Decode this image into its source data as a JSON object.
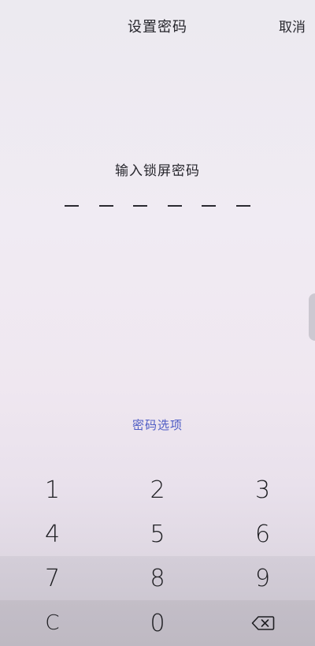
{
  "header": {
    "title": "设置密码",
    "cancel_label": "取消"
  },
  "pin": {
    "prompt": "输入锁屏密码",
    "length": 6,
    "entered": 0
  },
  "options": {
    "label": "密码选项",
    "color": "#4e5cc4"
  },
  "keypad": {
    "keys": [
      "1",
      "2",
      "3",
      "4",
      "5",
      "6",
      "7",
      "8",
      "9",
      "C",
      "0"
    ],
    "backspace_icon": "backspace-icon"
  }
}
